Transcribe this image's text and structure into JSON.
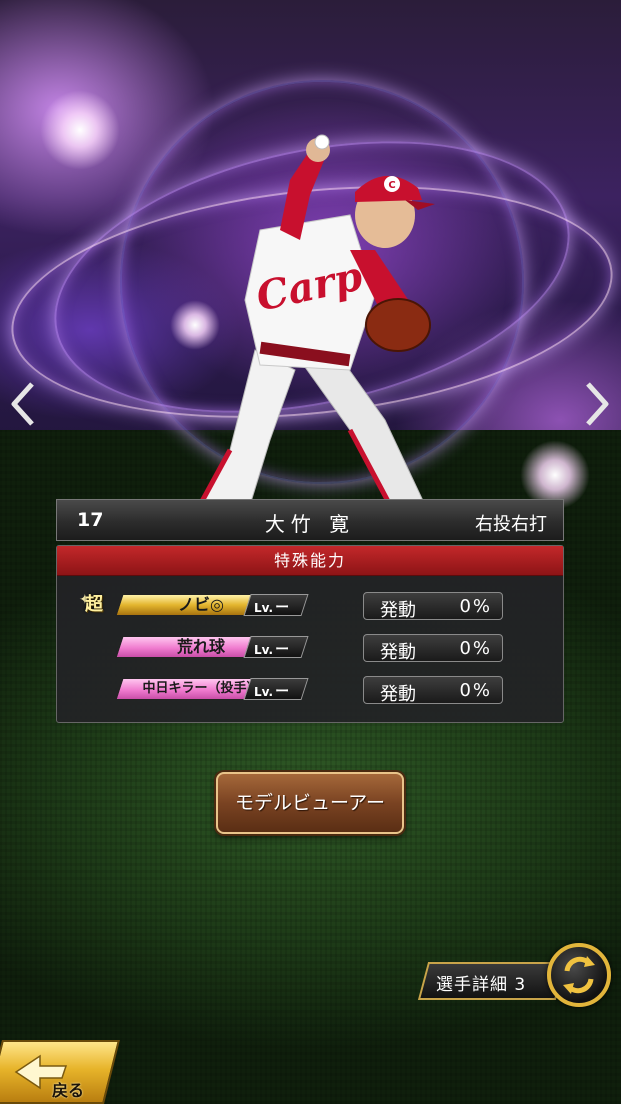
{
  "player": {
    "number": "17",
    "name": "大竹 寛",
    "handedness": "右投右打"
  },
  "abilities_panel": {
    "title": "特殊能力",
    "abilities": [
      {
        "super_mark": "超",
        "name": "ノビ◎",
        "level_label": "Lv.",
        "level_value": "ー",
        "activation_label": "発動",
        "activation_pct": "0%",
        "color": "#e3b52e"
      },
      {
        "name": "荒れ球",
        "level_label": "Lv.",
        "level_value": "ー",
        "activation_label": "発動",
        "activation_pct": "0%",
        "color": "#f07ccf"
      },
      {
        "name": "中日キラー（投手）",
        "level_label": "Lv.",
        "level_value": "ー",
        "activation_label": "発動",
        "activation_pct": "0%",
        "color": "#f07ccf"
      }
    ]
  },
  "buttons": {
    "model_viewer": "モデルビューアー",
    "player_detail": "選手詳細 3",
    "back": "戻る"
  },
  "icons": {
    "prev": "chevron-left-icon",
    "next": "chevron-right-icon",
    "cycle": "cycle-arrows-icon",
    "back": "back-arrow-icon"
  },
  "colors": {
    "header_red": "#c3282a",
    "gold_accent": "#e2b53b",
    "pink_badge": "#f07ccf"
  }
}
